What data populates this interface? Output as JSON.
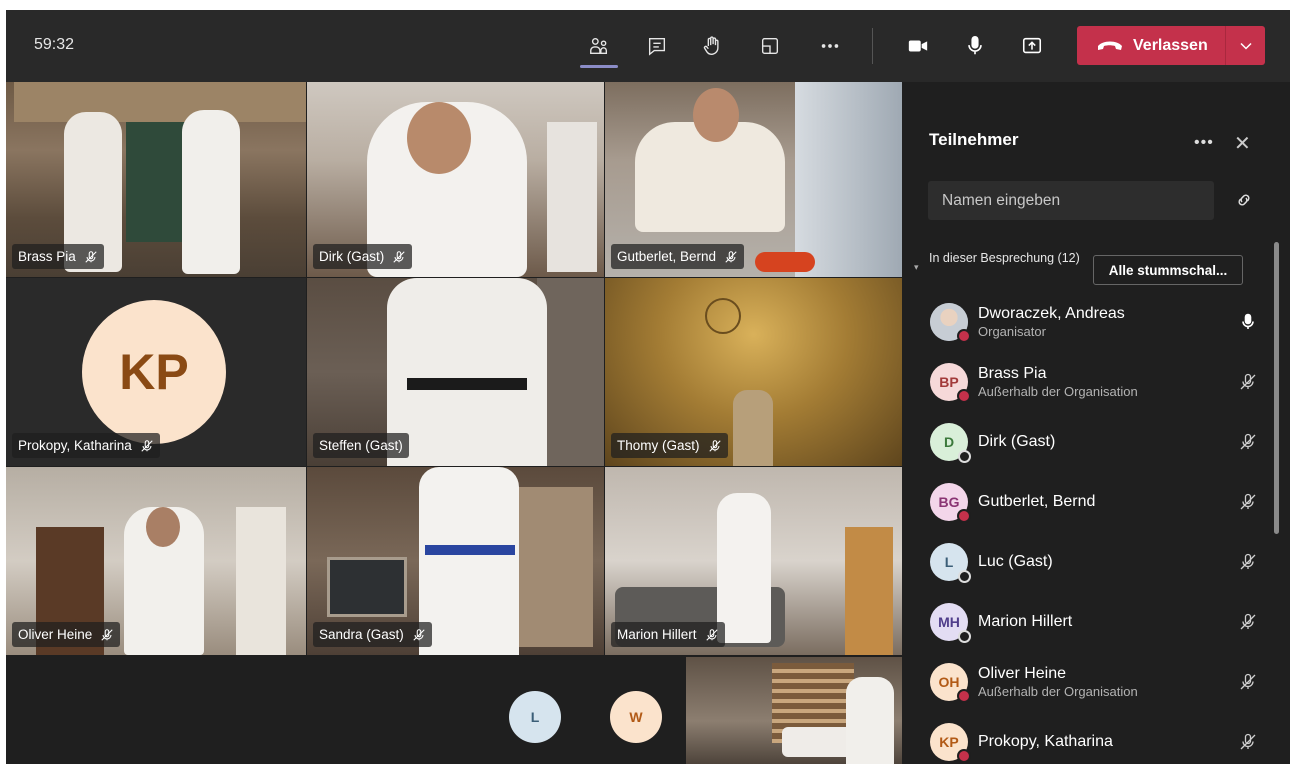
{
  "meeting": {
    "timer": "59:32",
    "leave_label": "Verlassen"
  },
  "video_tiles": [
    {
      "name": "Brass Pia",
      "muted": true
    },
    {
      "name": "Dirk (Gast)",
      "muted": true
    },
    {
      "name": "Gutberlet, Bernd",
      "muted": true
    },
    {
      "name": "Prokopy, Katharina",
      "muted": true,
      "initials": "KP"
    },
    {
      "name": "Steffen (Gast)",
      "muted": false
    },
    {
      "name": "Thomy (Gast)",
      "muted": true
    },
    {
      "name": "Oliver Heine",
      "muted": true
    },
    {
      "name": "Sandra (Gast)",
      "muted": true
    },
    {
      "name": "Marion Hillert",
      "muted": true
    }
  ],
  "bottom_strip": {
    "avatars": [
      "L",
      "W"
    ]
  },
  "panel": {
    "title": "Teilnehmer",
    "search_placeholder": "Namen eingeben",
    "section_label": "In dieser Besprechung (12)",
    "mute_all_label": "Alle stummschal...",
    "participants": [
      {
        "initials": "",
        "name": "Dworaczek, Andreas",
        "sub": "Organisator",
        "status": "busy",
        "mic": "on",
        "avatar_bg": "#8899aa",
        "avatar_fg": "#ffffff"
      },
      {
        "initials": "BP",
        "name": "Brass Pia",
        "sub": "Außerhalb der Organisation",
        "status": "busy",
        "mic": "muted",
        "avatar_bg": "#f6d9d9",
        "avatar_fg": "#a23a3a"
      },
      {
        "initials": "D",
        "name": "Dirk (Gast)",
        "sub": "",
        "status": "offline",
        "mic": "muted",
        "avatar_bg": "#d9efd9",
        "avatar_fg": "#3c7a3c"
      },
      {
        "initials": "BG",
        "name": "Gutberlet, Bernd",
        "sub": "",
        "status": "busy",
        "mic": "muted",
        "avatar_bg": "#f3d6ea",
        "avatar_fg": "#8a3473"
      },
      {
        "initials": "L",
        "name": "Luc (Gast)",
        "sub": "",
        "status": "offline",
        "mic": "muted",
        "avatar_bg": "#d6e4ee",
        "avatar_fg": "#3b5e77"
      },
      {
        "initials": "MH",
        "name": "Marion Hillert",
        "sub": "",
        "status": "offline",
        "mic": "muted",
        "avatar_bg": "#e3ddf3",
        "avatar_fg": "#4f3d8a"
      },
      {
        "initials": "OH",
        "name": "Oliver Heine",
        "sub": "Außerhalb der Organisation",
        "status": "busy",
        "mic": "muted",
        "avatar_bg": "#fbe3cc",
        "avatar_fg": "#b25a16"
      },
      {
        "initials": "KP",
        "name": "Prokopy, Katharina",
        "sub": "",
        "status": "busy",
        "mic": "muted",
        "avatar_bg": "#fbe3cc",
        "avatar_fg": "#b25a16"
      }
    ]
  },
  "colors": {
    "accent": "#8b8cc7",
    "leave": "#c4314b",
    "busy": "#c4314b"
  }
}
